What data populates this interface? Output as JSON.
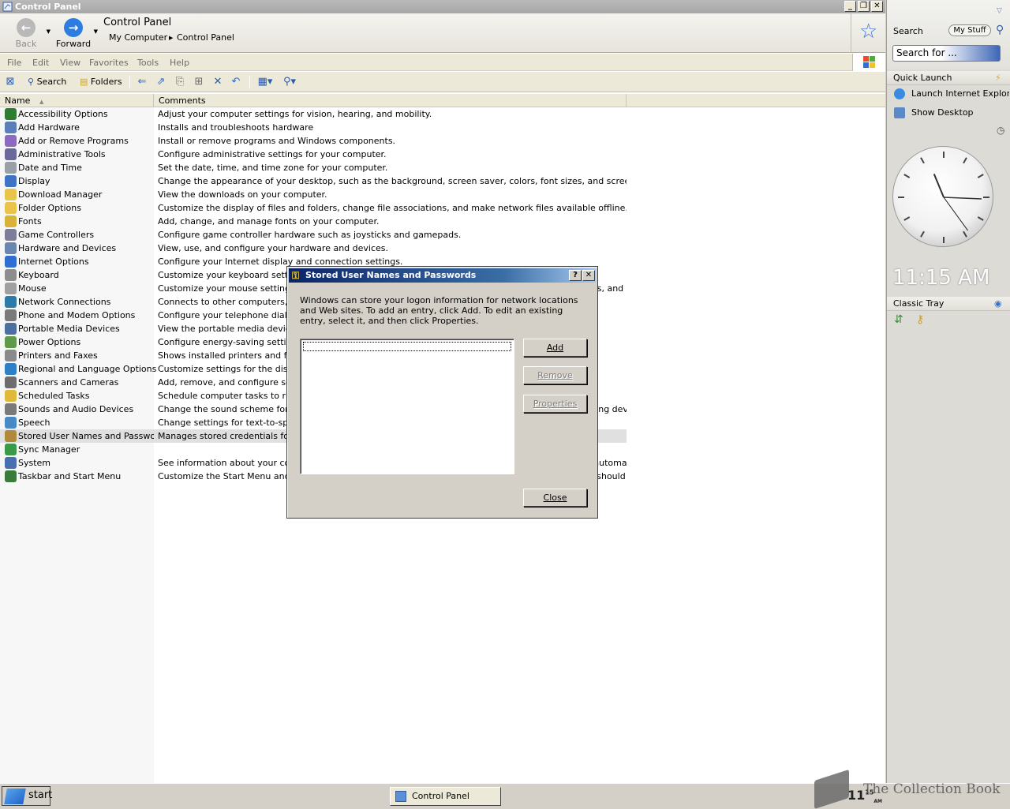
{
  "window": {
    "title": "Control Panel",
    "buttons": {
      "minimize": "_",
      "restore": "❐",
      "close": "✕"
    }
  },
  "nav": {
    "back": "Back",
    "forward": "Forward",
    "address_title": "Control Panel",
    "breadcrumb": [
      "My Computer",
      "Control Panel"
    ]
  },
  "menu": {
    "items": [
      "File",
      "Edit",
      "View",
      "Favorites",
      "Tools",
      "Help"
    ]
  },
  "toolbar": {
    "search": "Search",
    "folders": "Folders"
  },
  "columns": {
    "name": "Name",
    "comments": "Comments"
  },
  "items": [
    {
      "name": "Accessibility Options",
      "comment": "Adjust your computer settings for vision, hearing, and mobility.",
      "color": "#2e7d32"
    },
    {
      "name": "Add Hardware",
      "comment": "Installs and troubleshoots hardware",
      "color": "#5c7fb8"
    },
    {
      "name": "Add or Remove Programs",
      "comment": "Install or remove programs and Windows components.",
      "color": "#8a6bbf"
    },
    {
      "name": "Administrative Tools",
      "comment": "Configure administrative settings for your computer.",
      "color": "#6a6a9a"
    },
    {
      "name": "Date and Time",
      "comment": "Set the date, time, and time zone for your computer.",
      "color": "#9aa0a8"
    },
    {
      "name": "Display",
      "comment": "Change the appearance of your desktop, such as the background, screen saver, colors, font sizes, and screen resolution.",
      "color": "#3f73c4"
    },
    {
      "name": "Download Manager",
      "comment": "View the downloads on your computer.",
      "color": "#e8c44a"
    },
    {
      "name": "Folder Options",
      "comment": "Customize the display of files and folders, change file associations, and make network files available offline.",
      "color": "#e8c44a"
    },
    {
      "name": "Fonts",
      "comment": "Add, change, and manage fonts on your computer.",
      "color": "#d9b23a"
    },
    {
      "name": "Game Controllers",
      "comment": "Configure game controller hardware such as joysticks and gamepads.",
      "color": "#7d7d9a"
    },
    {
      "name": "Hardware and Devices",
      "comment": "View, use, and configure your hardware and devices.",
      "color": "#6a87b0"
    },
    {
      "name": "Internet Options",
      "comment": "Configure your Internet display and connection settings.",
      "color": "#2f6fd0"
    },
    {
      "name": "Keyboard",
      "comment": "Customize your keyboard settings, such as the cursor blink rate and the character repeat rate.",
      "color": "#8d8d8d"
    },
    {
      "name": "Mouse",
      "comment": "Customize your mouse settings, such as the button configuration, double-click speed, mouse pointers, and motion speed.",
      "color": "#a0a0a0"
    },
    {
      "name": "Network Connections",
      "comment": "Connects to other computers, networks, and the Internet.",
      "color": "#2e7aa8"
    },
    {
      "name": "Phone and Modem Options",
      "comment": "Configure your telephone dialing rules and modem properties.",
      "color": "#7a7a7a"
    },
    {
      "name": "Portable Media Devices",
      "comment": "View the portable media devices connected to your computer.",
      "color": "#4a6fa0"
    },
    {
      "name": "Power Options",
      "comment": "Configure energy-saving settings for your computer.",
      "color": "#5e9a4a"
    },
    {
      "name": "Printers and Faxes",
      "comment": "Shows installed printers and fax printers and helps you add new ones.",
      "color": "#8a8a8a"
    },
    {
      "name": "Regional and Language Options",
      "comment": "Customize settings for the display of languages, numbers, times, and dates.",
      "color": "#2f7fc4"
    },
    {
      "name": "Scanners and Cameras",
      "comment": "Add, remove, and configure scanners and cameras.",
      "color": "#6d6d6d"
    },
    {
      "name": "Scheduled Tasks",
      "comment": "Schedule computer tasks to run automatically.",
      "color": "#e0b83a"
    },
    {
      "name": "Sounds and Audio Devices",
      "comment": "Change the sound scheme for your computer, or configure the settings for your speakers and recording devices.",
      "color": "#7a7a7a"
    },
    {
      "name": "Speech",
      "comment": "Change settings for text-to-speech and for speech recognition, if installed.",
      "color": "#4a8ac4"
    },
    {
      "name": "Stored User Names and Passwords",
      "comment": "Manages stored credentials for network servers.",
      "color": "#b08a3a",
      "selected": true
    },
    {
      "name": "Sync Manager",
      "comment": "",
      "color": "#3a9a4a"
    },
    {
      "name": "System",
      "comment": "See information about your computer system, and change settings for hardware, performance, and automatic updates.",
      "color": "#4a6fb0"
    },
    {
      "name": "Taskbar and Start Menu",
      "comment": "Customize the Start Menu and the taskbar, such as the types of items to be displayed and how they should appear.",
      "color": "#3a7a3a"
    }
  ],
  "dialog": {
    "title": "Stored User Names and Passwords",
    "help": "?",
    "close_x": "✕",
    "description": "Windows can store your logon information for network locations and Web sites. To add an entry, click Add. To edit an existing entry, select it, and then click Properties.",
    "add": "Add",
    "remove": "Remove",
    "properties": "Properties",
    "close": "Close"
  },
  "sidebar": {
    "search_label": "Search",
    "my_stuff": "My Stuff",
    "search_placeholder": "Search for ...",
    "quick_launch": "Quick Launch",
    "launch_ie": "Launch Internet Explorer Browser",
    "show_desktop": "Show Desktop",
    "clock_time": "11:15 AM",
    "clock_hour": 11,
    "clock_minute": 15,
    "clock_second": 24,
    "classic_tray": "Classic Tray"
  },
  "taskbar": {
    "start": "start",
    "task": "Control Panel",
    "clock_hour": "11",
    "clock_minute": "15",
    "clock_ampm": "AM"
  },
  "watermark": "The Collection Book"
}
